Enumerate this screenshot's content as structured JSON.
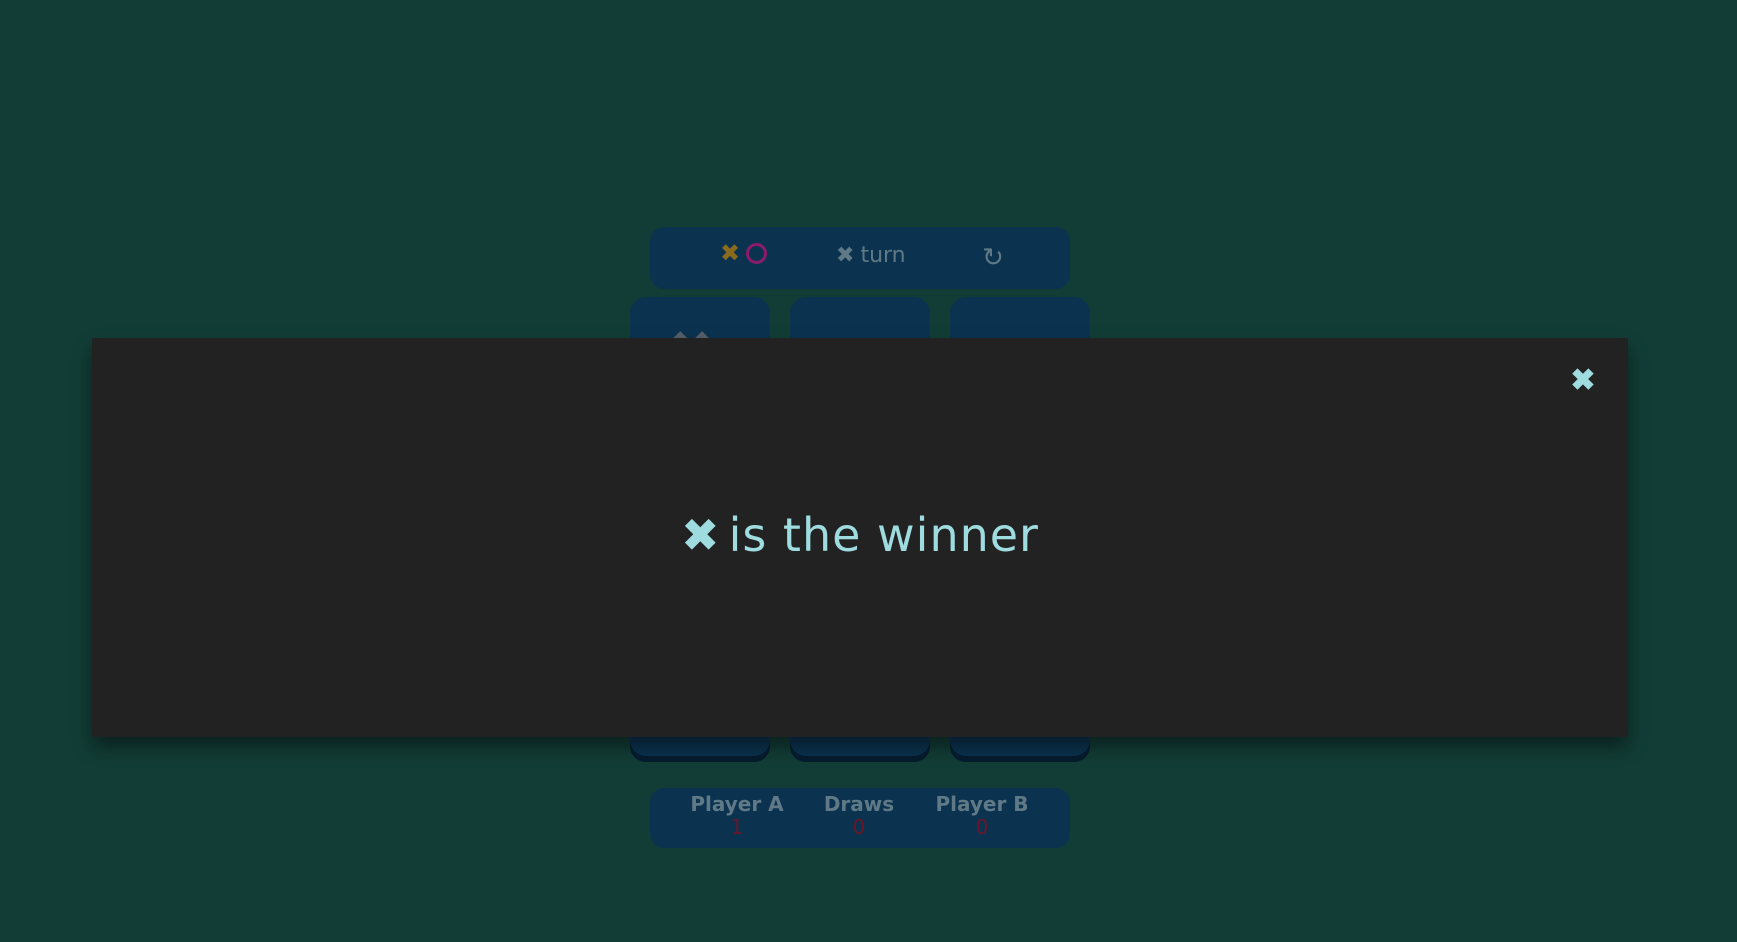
{
  "header": {
    "logo_x": "✖",
    "turn_symbol": "✖",
    "turn_label": "turn",
    "restart_icon": "↻"
  },
  "board": {
    "top_left_mark": "✖",
    "cells_visible": [
      "top-left",
      "top-middle",
      "top-right",
      "bottom-left",
      "bottom-middle",
      "bottom-right"
    ]
  },
  "scoreboard": {
    "player_a_label": "Player A",
    "player_a_score": "1",
    "draws_label": "Draws",
    "draws_score": "0",
    "player_b_label": "Player B",
    "player_b_score": "0"
  },
  "modal": {
    "close_icon": "✖",
    "winner_symbol": "✖",
    "winner_text": "is the winner"
  },
  "colors": {
    "background": "#123d36",
    "panel": "#0b3350",
    "modal_bg": "#222222",
    "accent_text": "#9fdce0",
    "x_color": "#8a6a1e",
    "o_color": "#8a1c6a",
    "score_color": "#6b1628"
  }
}
